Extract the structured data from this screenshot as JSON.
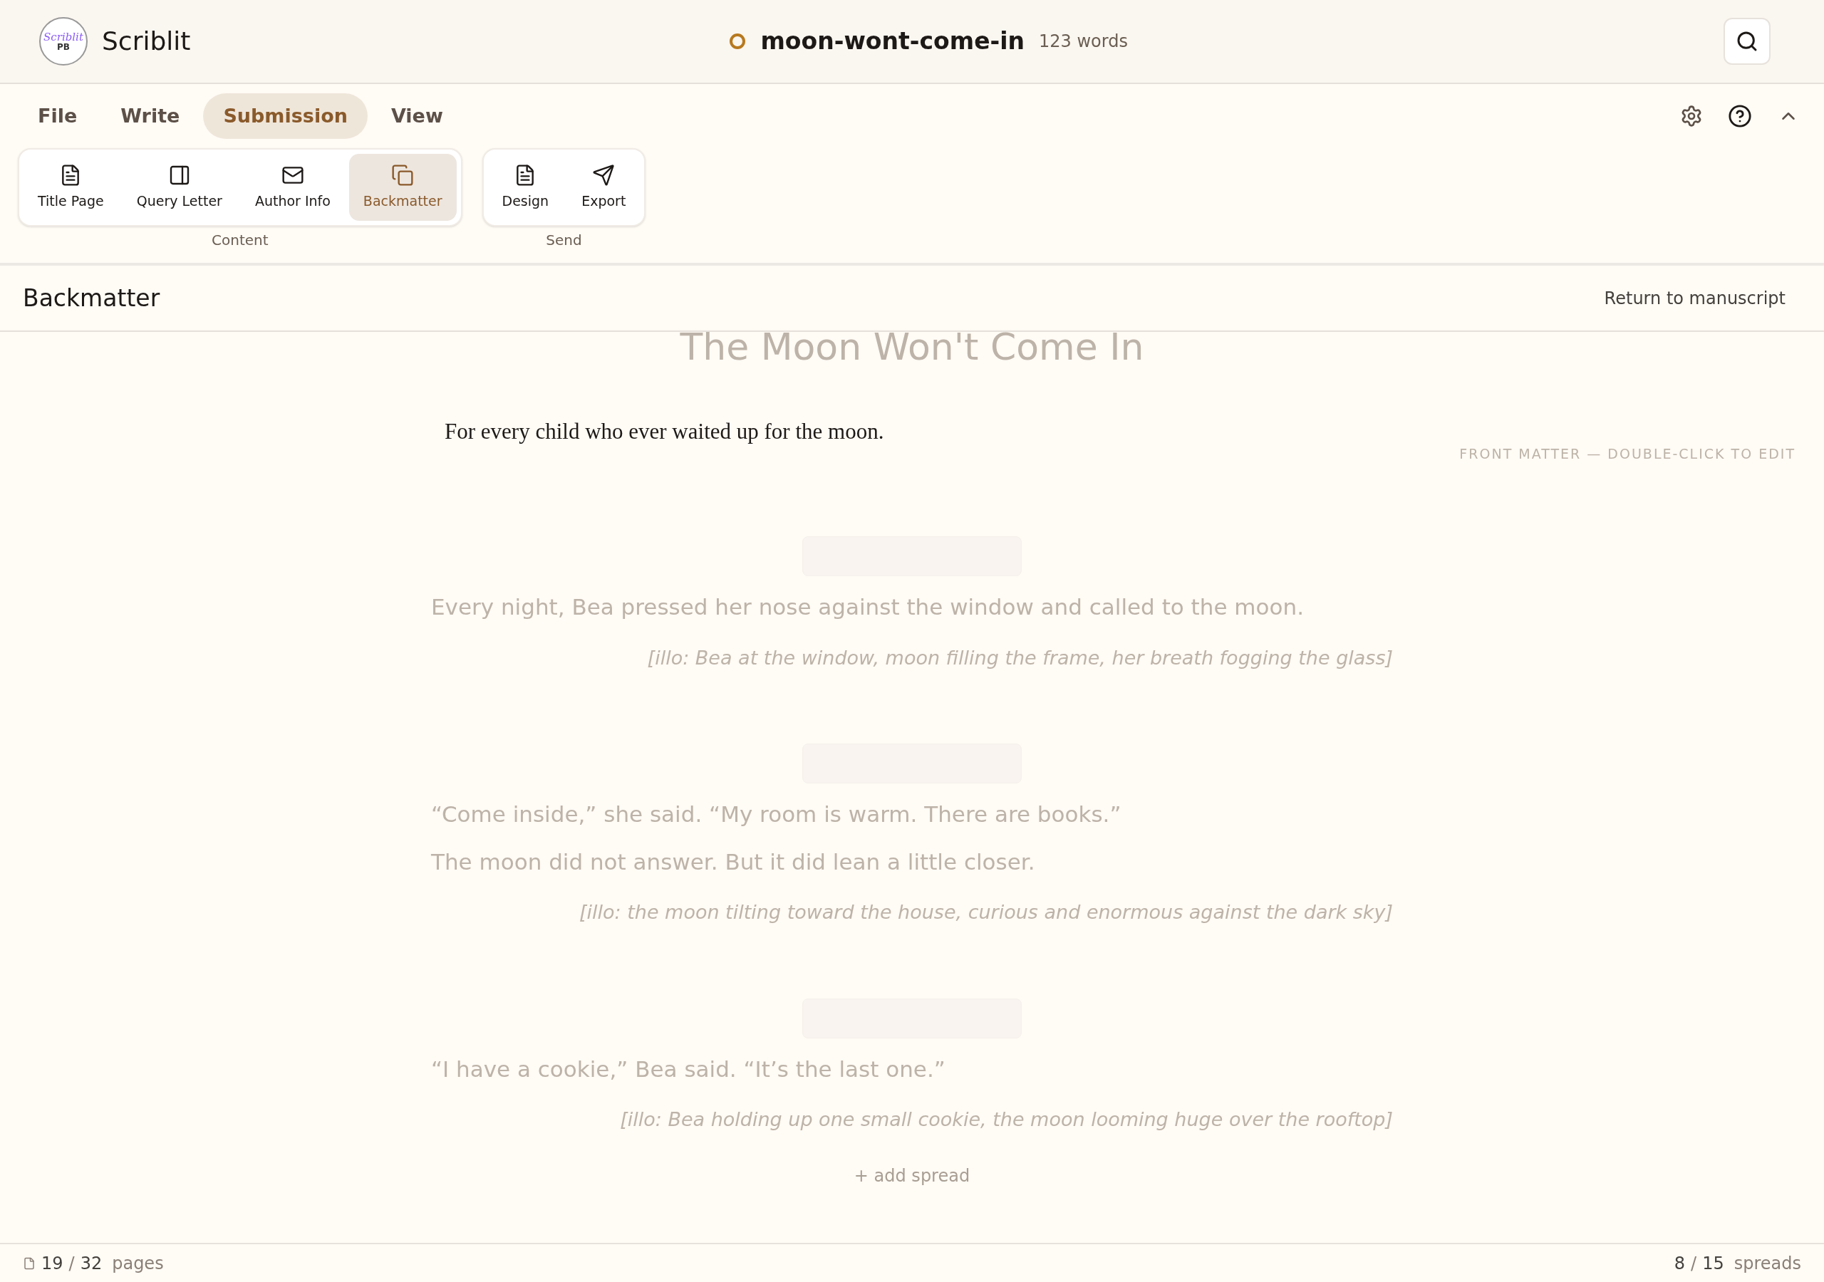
{
  "app": {
    "name": "Scriblit",
    "logo": {
      "script": "Scriblit",
      "badge": "PB"
    }
  },
  "document": {
    "title": "moon-wont-come-in",
    "word_count": "123 words"
  },
  "tabs": [
    {
      "label": "File",
      "selected": false
    },
    {
      "label": "Write",
      "selected": false
    },
    {
      "label": "Submission",
      "selected": true
    },
    {
      "label": "View",
      "selected": false
    }
  ],
  "ribbon_groups": [
    {
      "label": "Content",
      "items": [
        {
          "label": "Title Page",
          "selected": false
        },
        {
          "label": "Query Letter",
          "selected": false
        },
        {
          "label": "Author Info",
          "selected": false
        },
        {
          "label": "Backmatter",
          "selected": true
        }
      ]
    },
    {
      "label": "Send",
      "items": [
        {
          "label": "Design",
          "selected": false
        },
        {
          "label": "Export",
          "selected": false
        }
      ]
    }
  ],
  "panel": {
    "title": "Backmatter",
    "return_link": "Return to manuscript",
    "dedication": "For every child who ever waited up for the moon."
  },
  "manuscript": {
    "title": "The Moon Won't Come In",
    "front_matter_hint": "FRONT MATTER — DOUBLE-CLICK TO EDIT",
    "spreads": [
      {
        "paragraphs": [
          "Every night, Bea pressed her nose against the window and called to the moon."
        ],
        "illo": "[illo: Bea at the window, moon filling the frame, her breath fogging the glass]"
      },
      {
        "paragraphs": [
          "“Come inside,” she said. “My room is warm. There are books.”",
          "The moon did not answer. But it did lean a little closer."
        ],
        "illo": "[illo: the moon tilting toward the house, curious and enormous against the dark sky]"
      },
      {
        "paragraphs": [
          "“I have a cookie,” Bea said. “It’s the last one.”"
        ],
        "illo": "[illo: Bea holding up one small cookie, the moon looming huge over the rooftop]"
      }
    ],
    "add_spread": "+ add spread"
  },
  "status_bar": {
    "separator": "/",
    "pages_current": "19",
    "pages_total": "32",
    "pages_unit": "pages",
    "spreads_current": "8",
    "spreads_total": "15",
    "spreads_unit": "spreads"
  }
}
